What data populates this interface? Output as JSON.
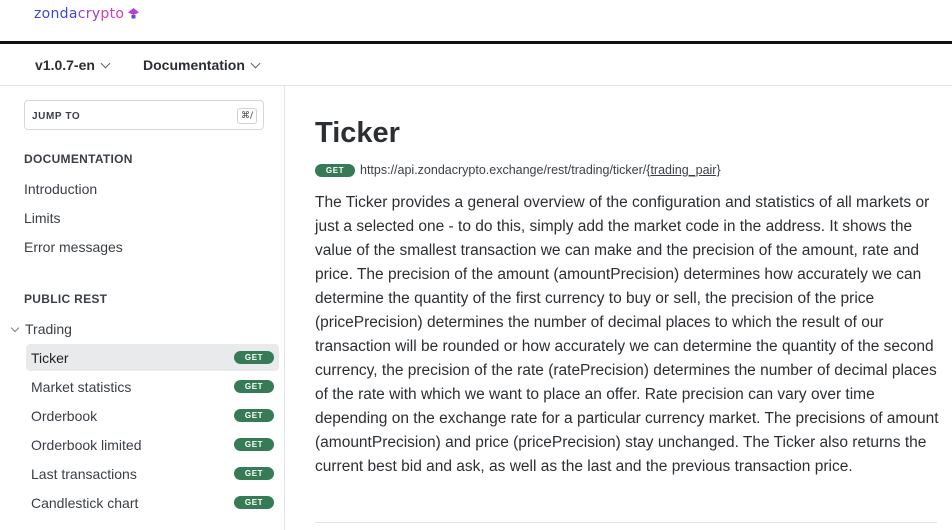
{
  "header": {
    "logo": {
      "part1": "zonda",
      "part2": "cry",
      "part3": "pto"
    }
  },
  "subnav": {
    "version": "v1.0.7-en",
    "section": "Documentation"
  },
  "sidebar": {
    "jump": {
      "label": "JUMP TO",
      "shortcut": "⌘/"
    },
    "documentation_heading": "DOCUMENTATION",
    "doc_items": [
      "Introduction",
      "Limits",
      "Error messages"
    ],
    "public_rest_heading": "PUBLIC REST",
    "group_label": "Trading",
    "endpoints": [
      {
        "label": "Ticker",
        "method": "GET",
        "active": true
      },
      {
        "label": "Market statistics",
        "method": "GET",
        "active": false
      },
      {
        "label": "Orderbook",
        "method": "GET",
        "active": false
      },
      {
        "label": "Orderbook limited",
        "method": "GET",
        "active": false
      },
      {
        "label": "Last transactions",
        "method": "GET",
        "active": false
      },
      {
        "label": "Candlestick chart",
        "method": "GET",
        "active": false
      }
    ]
  },
  "main": {
    "title": "Ticker",
    "method": "GET",
    "url": "https://api.zondacrypto.exchange/rest/trading/ticker/",
    "url_param": "{trading_pair}",
    "description": "The Ticker provides a general overview of the configuration and statistics of all markets or just a selected one - to do this, simply add the market code in the address. It shows the value of the smallest transaction we can make and the precision of the amount, rate and price. The precision of the amount (amountPrecision) determines how accurately we can determine the quantity of the first currency to buy or sell, the precision of the price (pricePrecision) determines the number of decimal places to which the result of our transaction will be rounded or how accurately we can determine the quantity of the second currency, the precision of the rate (ratePrecision) determines the number of decimal places of the rate with which we want to place an offer. Rate precision can vary over time depending on the exchange rate for a particular currency market. The precisions of amount (amountPrecision) and price (pricePrecision) stay unchanged. The Ticker also returns the current best bid and ask, as well as the last and the previous transaction price."
  },
  "colors": {
    "badge_green": "#367b56",
    "active_bg": "#e9eaec",
    "logo_blue": "#3b49d6",
    "logo_purple": "#9a3ed1",
    "logo_pink": "#d13fb0"
  }
}
